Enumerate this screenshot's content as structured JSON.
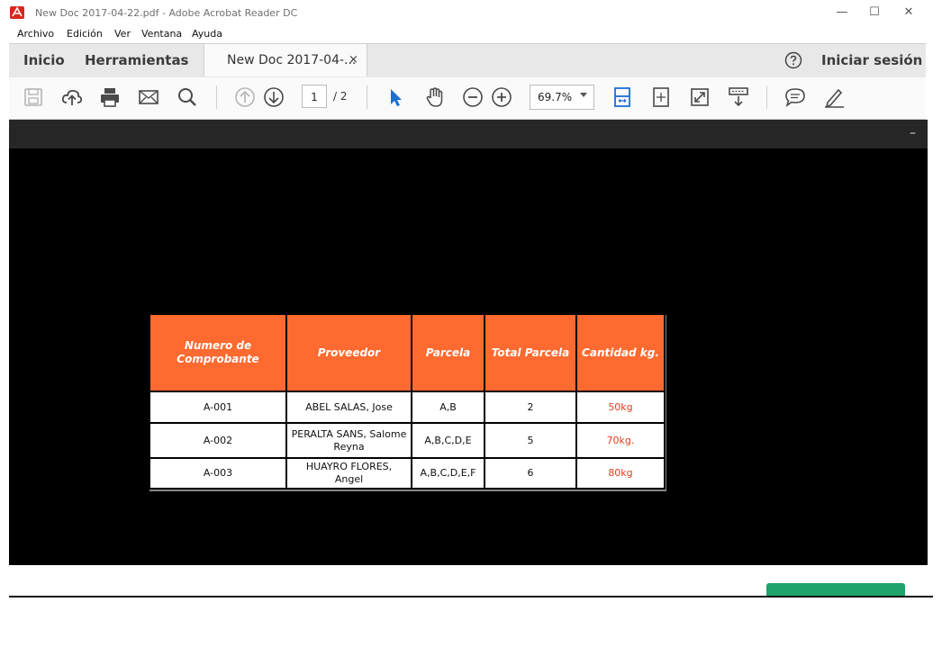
{
  "window": {
    "title": "New Doc 2017-04-22.pdf - Adobe Acrobat Reader DC",
    "controls": {
      "minimize": "—",
      "maximize": "☐",
      "close": "✕"
    }
  },
  "menu": [
    "Archivo",
    "Edición",
    "Ver",
    "Ventana",
    "Ayuda"
  ],
  "tabs": {
    "home": "Inicio",
    "tools": "Herramientas",
    "document": "New Doc 2017-04-...",
    "close_glyph": "×",
    "sign_in": "Iniciar sesión"
  },
  "toolbar": {
    "icons": [
      "save-icon",
      "upload-cloud-icon",
      "print-icon",
      "email-icon",
      "search-icon",
      "page-up-icon",
      "page-down-icon",
      "select-cursor-icon",
      "hand-tool-icon",
      "zoom-out-icon",
      "zoom-in-icon",
      "fit-width-icon",
      "fit-page-icon",
      "full-screen-icon",
      "read-mode-icon",
      "comment-icon",
      "highlight-pen-icon"
    ],
    "page_current": "1",
    "page_total": "/ 2",
    "zoom": "69.7%"
  },
  "colors": {
    "header_orange": "#ff6a30",
    "quantity_red": "#e0401e",
    "accent_blue": "#1c6fd1",
    "green_button": "#1ea36b"
  },
  "table": {
    "headers": [
      "Numero de Comprobante",
      "Proveedor",
      "Parcela",
      "Total Parcela",
      "Cantidad kg."
    ],
    "rows": [
      [
        "A-001",
        "ABEL SALAS, Jose",
        "A,B",
        "2",
        "50kg"
      ],
      [
        "A-002",
        "PERALTA SANS, Salome Reyna",
        "A,B,C,D,E",
        "5",
        "70kg."
      ],
      [
        "A-003",
        "HUAYRO FLORES, Angel",
        "A,B,C,D,E,F",
        "6",
        "80kg"
      ]
    ]
  }
}
